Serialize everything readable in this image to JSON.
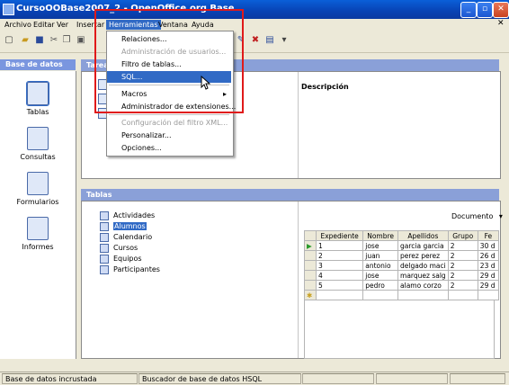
{
  "window": {
    "title": "CursoOOBase2007_2 - OpenOffice.org Base"
  },
  "menubar": [
    "Archivo",
    "Editar",
    "Ver",
    "Insertar",
    "Herramientas",
    "Ventana",
    "Ayuda"
  ],
  "herramientas_menu": [
    {
      "label": "Relaciones...",
      "disabled": false
    },
    {
      "label": "Administración de usuarios...",
      "disabled": true
    },
    {
      "label": "Filtro de tablas...",
      "disabled": false
    },
    {
      "label": "SQL...",
      "disabled": false,
      "highlighted": true
    },
    {
      "label": "Macros",
      "disabled": false,
      "submenu": true
    },
    {
      "label": "Administrador de extensiones...",
      "disabled": false
    },
    {
      "label": "Configuración del filtro XML...",
      "disabled": true
    },
    {
      "label": "Personalizar...",
      "disabled": false
    },
    {
      "label": "Opciones...",
      "disabled": false
    }
  ],
  "left_panel": {
    "header": "Base de datos",
    "items": [
      "Tablas",
      "Consultas",
      "Formularios",
      "Informes"
    ]
  },
  "tareas_panel": {
    "header": "Tareas",
    "descripcion_label": "Descripción"
  },
  "tablas_panel": {
    "header": "Tablas",
    "tables": [
      "Actividades",
      "Alumnos",
      "Calendario",
      "Cursos",
      "Equipos",
      "Participantes"
    ],
    "selected": "Alumnos",
    "preview_mode": "Documento"
  },
  "grid": {
    "columns": [
      "Expediente",
      "Nombre",
      "Apellidos",
      "Grupo",
      "Fe"
    ],
    "rows": [
      [
        "1",
        "jose",
        "garcia garcia",
        "2",
        "30 d"
      ],
      [
        "2",
        "juan",
        "perez perez",
        "2",
        "26 d"
      ],
      [
        "3",
        "antonio",
        "delgado maci",
        "2",
        "23 d"
      ],
      [
        "4",
        "jose",
        "marquez salg",
        "2",
        "29 d"
      ],
      [
        "5",
        "pedro",
        "alamo corzo",
        "2",
        "29 d"
      ]
    ]
  },
  "statusbar": [
    "Base de datos incrustada",
    "Buscador de base de datos HSQL"
  ],
  "colors": {
    "highlight": "#316ac5",
    "annotation_box": "#e01a1a",
    "titlebar": "#0842b4"
  }
}
